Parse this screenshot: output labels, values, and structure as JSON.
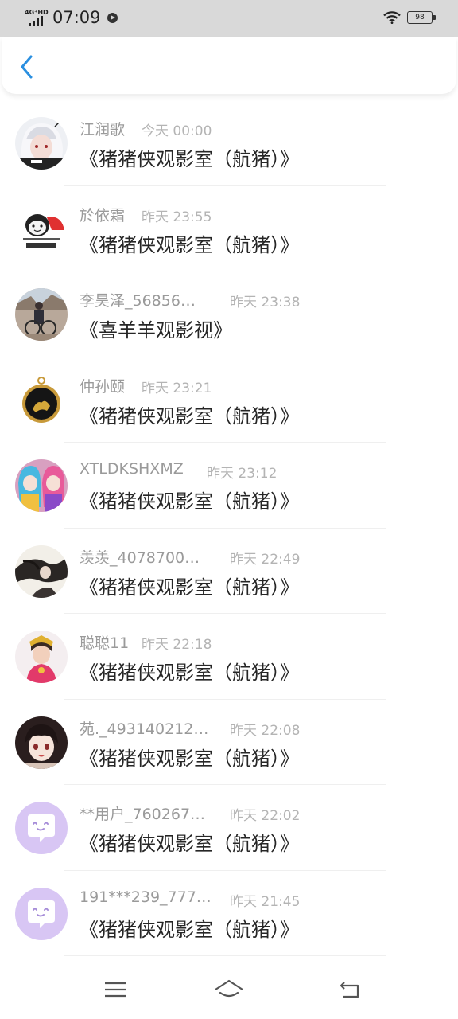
{
  "status_bar": {
    "network": "4G⁺HD",
    "time": "07:09",
    "battery": "98"
  },
  "header": {
    "back_icon": "chevron-left-icon",
    "accent_color": "#2a8fe0"
  },
  "messages": [
    {
      "name": "江润歌",
      "time": "今天 00:00",
      "text": "《猪猪侠观影室（航猪）》",
      "avatar": "anime-white-hair-avatar"
    },
    {
      "name": "於依霜",
      "time": "昨天 23:55",
      "text": "《猪猪侠观影室（航猪）》",
      "avatar": "meme-avatar"
    },
    {
      "name": "李昊泽_56856…",
      "time": "昨天 23:38",
      "text": "《喜羊羊观影视》",
      "avatar": "cyclist-photo-avatar"
    },
    {
      "name": "仲孙颐",
      "time": "昨天 23:21",
      "text": "《猪猪侠观影室（航猪）》",
      "avatar": "pocket-watch-avatar"
    },
    {
      "name": "XTLDKSHXMZ",
      "time": "昨天 23:12",
      "text": "《猪猪侠观影室（航猪）》",
      "avatar": "anime-twins-avatar"
    },
    {
      "name": "羡羡_4078700…",
      "time": "昨天 22:49",
      "text": "《猪猪侠观影室（航猪）》",
      "avatar": "ink-painting-avatar"
    },
    {
      "name": "聪聪11",
      "time": "昨天 22:18",
      "text": "《猪猪侠观影室（航猪）》",
      "avatar": "costume-girl-avatar"
    },
    {
      "name": "苑._493140212…",
      "time": "昨天 22:08",
      "text": "《猪猪侠观影室（航猪）》",
      "avatar": "anime-girl-avatar"
    },
    {
      "name": "**用户_760267…",
      "time": "昨天 22:02",
      "text": "《猪猪侠观影室（航猪）》",
      "avatar": "default-chat-avatar"
    },
    {
      "name": "191***239_777…",
      "time": "昨天 21:45",
      "text": "《猪猪侠观影室（航猪）》",
      "avatar": "default-chat-avatar"
    }
  ],
  "bottom_nav": {
    "menu_icon": "menu-icon",
    "home_icon": "home-icon",
    "back_icon": "back-arrow-icon"
  }
}
